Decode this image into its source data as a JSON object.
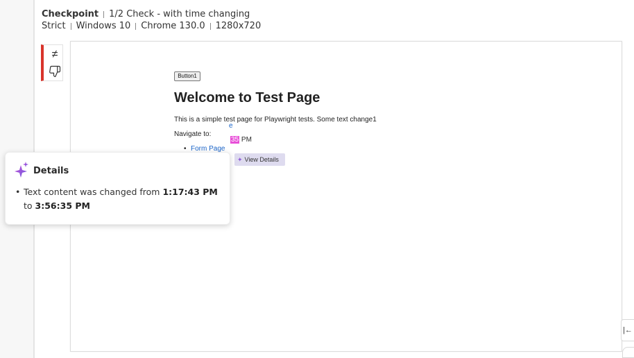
{
  "header": {
    "title": "Checkpoint",
    "subtitle": "1/2 Check - with time changing",
    "env": [
      "Strict",
      "Windows 10",
      "Chrome 130.0",
      "1280x720"
    ]
  },
  "rail": {
    "icons": [
      "not-equal-icon",
      "thumbs-down-icon"
    ],
    "accent_color": "#d9342b"
  },
  "preview": {
    "button_label": "Button1",
    "heading": "Welcome to Test Page",
    "paragraph": "This is a simple test page for Playwright tests. Some text change1",
    "navigate_label": "Navigate to:",
    "links": [
      "Form Page"
    ],
    "partial_link": "e",
    "time_highlight": "35",
    "time_suffix": "PM"
  },
  "view_details": {
    "label": "View Details"
  },
  "details": {
    "title": "Details",
    "text_before": "Text content was changed from ",
    "from_value": "1:17:43 PM",
    "text_to": " to ",
    "to_value": "3:56:35 PM"
  },
  "edge": {
    "label": "|←"
  },
  "colors": {
    "highlight": "#e84fd8",
    "link": "#1a64c8",
    "view_details_bg": "#dedbef",
    "spark": "#8d5ad6"
  }
}
